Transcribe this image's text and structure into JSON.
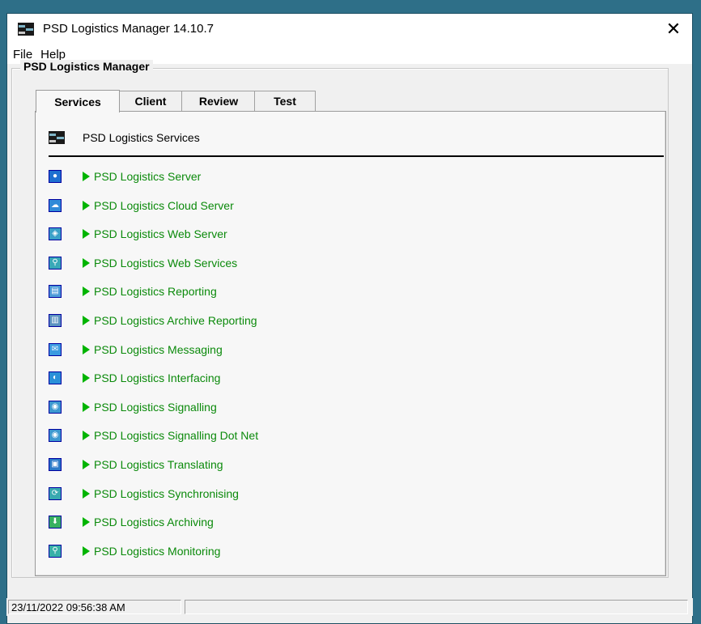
{
  "window": {
    "title": "PSD Logistics Manager 14.10.7",
    "close_glyph": "✕"
  },
  "menu": [
    {
      "label": "File"
    },
    {
      "label": "Help"
    }
  ],
  "group": {
    "label": "PSD Logistics Manager"
  },
  "tabs": [
    {
      "label": "Services",
      "active": true
    },
    {
      "label": "Client",
      "active": false
    },
    {
      "label": "Review",
      "active": false
    },
    {
      "label": "Test",
      "active": false
    }
  ],
  "panel": {
    "header": "PSD Logistics Services"
  },
  "services": [
    {
      "label": "PSD Logistics Server",
      "icon": "globe-icon"
    },
    {
      "label": "PSD Logistics Cloud Server",
      "icon": "cloud-icon"
    },
    {
      "label": "PSD Logistics Web Server",
      "icon": "web-icon"
    },
    {
      "label": "PSD Logistics Web Services",
      "icon": "web-services-icon"
    },
    {
      "label": "PSD Logistics Reporting",
      "icon": "report-icon"
    },
    {
      "label": "PSD Logistics Archive Reporting",
      "icon": "archive-report-icon"
    },
    {
      "label": "PSD Logistics Messaging",
      "icon": "envelope-icon"
    },
    {
      "label": "PSD Logistics Interfacing",
      "icon": "plug-icon"
    },
    {
      "label": "PSD Logistics Signalling",
      "icon": "signal-icon"
    },
    {
      "label": "PSD Logistics Signalling Dot Net",
      "icon": "signal-dotnet-icon"
    },
    {
      "label": "PSD Logistics Translating",
      "icon": "translate-icon"
    },
    {
      "label": "PSD Logistics Synchronising",
      "icon": "sync-icon"
    },
    {
      "label": "PSD Logistics Archiving",
      "icon": "download-icon"
    },
    {
      "label": "PSD Logistics Monitoring",
      "icon": "magnifier-icon"
    }
  ],
  "status": {
    "datetime": "23/11/2022 09:56:38 AM",
    "message": ""
  },
  "colors": {
    "accent": "#0b8a0b",
    "play": "#00b400",
    "desktop": "#2e6f88"
  }
}
